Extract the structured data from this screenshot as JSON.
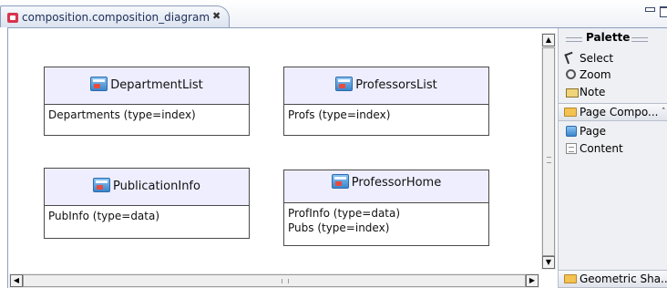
{
  "tab": {
    "title": "composition.composition_diagram",
    "close_glyph": "✖"
  },
  "nodes": [
    {
      "title": "DepartmentList",
      "rows": [
        "Departments (type=index)"
      ]
    },
    {
      "title": "ProfessorsList",
      "rows": [
        "Profs (type=index)"
      ]
    },
    {
      "title": "PublicationInfo",
      "rows": [
        "PubInfo (type=data)"
      ]
    },
    {
      "title": "ProfessorHome",
      "rows": [
        "ProfInfo (type=data)",
        "Pubs (type=index)"
      ]
    }
  ],
  "palette": {
    "title": "Palette",
    "tools": [
      {
        "label": "Select",
        "icon": "select-arrow-icon"
      },
      {
        "label": "Zoom",
        "icon": "zoom-icon"
      },
      {
        "label": "Note",
        "icon": "note-icon"
      }
    ],
    "drawer": {
      "label": "Page Compo...",
      "icon": "folder-icon"
    },
    "drawer_items": [
      {
        "label": "Page",
        "icon": "page-icon"
      },
      {
        "label": "Content",
        "icon": "content-icon"
      }
    ],
    "bottom_drawer": {
      "label": "Geometric Sha...",
      "icon": "folder-icon"
    }
  },
  "scrollbars": {
    "up_glyph": "▲",
    "down_glyph": "▼",
    "left_glyph": "◀",
    "right_glyph": "▶"
  }
}
